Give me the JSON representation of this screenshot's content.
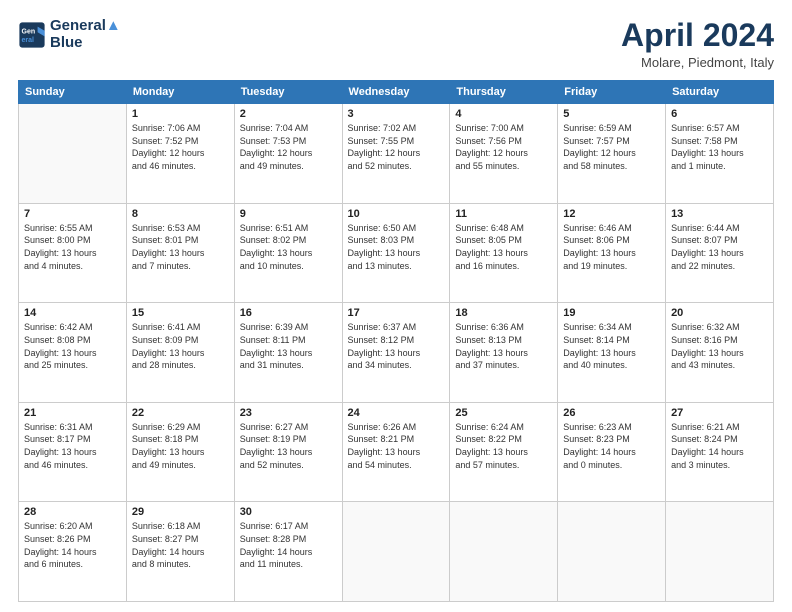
{
  "header": {
    "logo": {
      "line1": "General",
      "line2": "Blue"
    },
    "title": "April 2024",
    "location": "Molare, Piedmont, Italy"
  },
  "days_of_week": [
    "Sunday",
    "Monday",
    "Tuesday",
    "Wednesday",
    "Thursday",
    "Friday",
    "Saturday"
  ],
  "weeks": [
    [
      {
        "day": "",
        "info": ""
      },
      {
        "day": "1",
        "info": "Sunrise: 7:06 AM\nSunset: 7:52 PM\nDaylight: 12 hours\nand 46 minutes."
      },
      {
        "day": "2",
        "info": "Sunrise: 7:04 AM\nSunset: 7:53 PM\nDaylight: 12 hours\nand 49 minutes."
      },
      {
        "day": "3",
        "info": "Sunrise: 7:02 AM\nSunset: 7:55 PM\nDaylight: 12 hours\nand 52 minutes."
      },
      {
        "day": "4",
        "info": "Sunrise: 7:00 AM\nSunset: 7:56 PM\nDaylight: 12 hours\nand 55 minutes."
      },
      {
        "day": "5",
        "info": "Sunrise: 6:59 AM\nSunset: 7:57 PM\nDaylight: 12 hours\nand 58 minutes."
      },
      {
        "day": "6",
        "info": "Sunrise: 6:57 AM\nSunset: 7:58 PM\nDaylight: 13 hours\nand 1 minute."
      }
    ],
    [
      {
        "day": "7",
        "info": "Sunrise: 6:55 AM\nSunset: 8:00 PM\nDaylight: 13 hours\nand 4 minutes."
      },
      {
        "day": "8",
        "info": "Sunrise: 6:53 AM\nSunset: 8:01 PM\nDaylight: 13 hours\nand 7 minutes."
      },
      {
        "day": "9",
        "info": "Sunrise: 6:51 AM\nSunset: 8:02 PM\nDaylight: 13 hours\nand 10 minutes."
      },
      {
        "day": "10",
        "info": "Sunrise: 6:50 AM\nSunset: 8:03 PM\nDaylight: 13 hours\nand 13 minutes."
      },
      {
        "day": "11",
        "info": "Sunrise: 6:48 AM\nSunset: 8:05 PM\nDaylight: 13 hours\nand 16 minutes."
      },
      {
        "day": "12",
        "info": "Sunrise: 6:46 AM\nSunset: 8:06 PM\nDaylight: 13 hours\nand 19 minutes."
      },
      {
        "day": "13",
        "info": "Sunrise: 6:44 AM\nSunset: 8:07 PM\nDaylight: 13 hours\nand 22 minutes."
      }
    ],
    [
      {
        "day": "14",
        "info": "Sunrise: 6:42 AM\nSunset: 8:08 PM\nDaylight: 13 hours\nand 25 minutes."
      },
      {
        "day": "15",
        "info": "Sunrise: 6:41 AM\nSunset: 8:09 PM\nDaylight: 13 hours\nand 28 minutes."
      },
      {
        "day": "16",
        "info": "Sunrise: 6:39 AM\nSunset: 8:11 PM\nDaylight: 13 hours\nand 31 minutes."
      },
      {
        "day": "17",
        "info": "Sunrise: 6:37 AM\nSunset: 8:12 PM\nDaylight: 13 hours\nand 34 minutes."
      },
      {
        "day": "18",
        "info": "Sunrise: 6:36 AM\nSunset: 8:13 PM\nDaylight: 13 hours\nand 37 minutes."
      },
      {
        "day": "19",
        "info": "Sunrise: 6:34 AM\nSunset: 8:14 PM\nDaylight: 13 hours\nand 40 minutes."
      },
      {
        "day": "20",
        "info": "Sunrise: 6:32 AM\nSunset: 8:16 PM\nDaylight: 13 hours\nand 43 minutes."
      }
    ],
    [
      {
        "day": "21",
        "info": "Sunrise: 6:31 AM\nSunset: 8:17 PM\nDaylight: 13 hours\nand 46 minutes."
      },
      {
        "day": "22",
        "info": "Sunrise: 6:29 AM\nSunset: 8:18 PM\nDaylight: 13 hours\nand 49 minutes."
      },
      {
        "day": "23",
        "info": "Sunrise: 6:27 AM\nSunset: 8:19 PM\nDaylight: 13 hours\nand 52 minutes."
      },
      {
        "day": "24",
        "info": "Sunrise: 6:26 AM\nSunset: 8:21 PM\nDaylight: 13 hours\nand 54 minutes."
      },
      {
        "day": "25",
        "info": "Sunrise: 6:24 AM\nSunset: 8:22 PM\nDaylight: 13 hours\nand 57 minutes."
      },
      {
        "day": "26",
        "info": "Sunrise: 6:23 AM\nSunset: 8:23 PM\nDaylight: 14 hours\nand 0 minutes."
      },
      {
        "day": "27",
        "info": "Sunrise: 6:21 AM\nSunset: 8:24 PM\nDaylight: 14 hours\nand 3 minutes."
      }
    ],
    [
      {
        "day": "28",
        "info": "Sunrise: 6:20 AM\nSunset: 8:26 PM\nDaylight: 14 hours\nand 6 minutes."
      },
      {
        "day": "29",
        "info": "Sunrise: 6:18 AM\nSunset: 8:27 PM\nDaylight: 14 hours\nand 8 minutes."
      },
      {
        "day": "30",
        "info": "Sunrise: 6:17 AM\nSunset: 8:28 PM\nDaylight: 14 hours\nand 11 minutes."
      },
      {
        "day": "",
        "info": ""
      },
      {
        "day": "",
        "info": ""
      },
      {
        "day": "",
        "info": ""
      },
      {
        "day": "",
        "info": ""
      }
    ]
  ]
}
